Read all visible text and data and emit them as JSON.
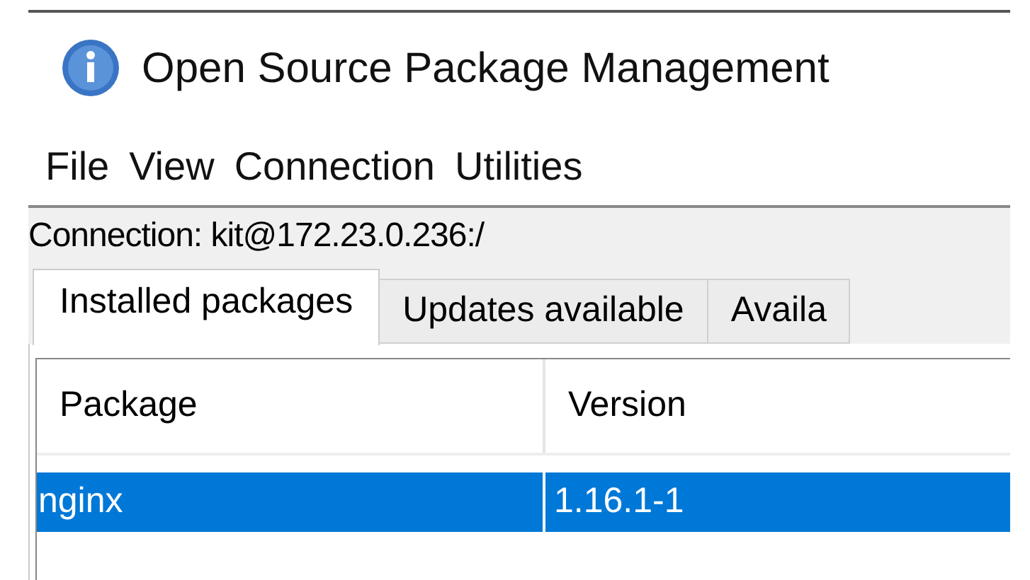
{
  "window": {
    "title": "Open Source Package Management"
  },
  "menu": [
    "File",
    "View",
    "Connection",
    "Utilities"
  ],
  "connection": "Connection: kit@172.23.0.236:/",
  "tabs": [
    {
      "label": "Installed packages",
      "selected": true
    },
    {
      "label": "Updates available",
      "selected": false
    },
    {
      "label": "Availa",
      "selected": false
    }
  ],
  "table": {
    "columns": [
      "Package",
      "Version"
    ],
    "rows": [
      {
        "cells": [
          "nginx",
          "1.16.1-1"
        ],
        "selected": true
      }
    ]
  }
}
